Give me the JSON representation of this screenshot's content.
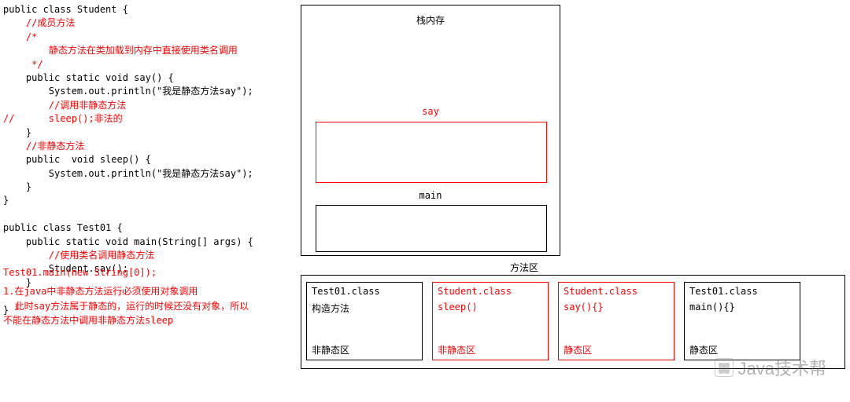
{
  "code": {
    "lines": [
      {
        "t": "public class Student {",
        "c": "blk"
      },
      {
        "t": "    //成员方法",
        "c": "red"
      },
      {
        "t": "    /*",
        "c": "red"
      },
      {
        "t": "        静态方法在类加载到内存中直接使用类名调用",
        "c": "red"
      },
      {
        "t": "     */",
        "c": "red"
      },
      {
        "t": "    public static void say() {",
        "c": "blk"
      },
      {
        "t": "        System.out.println(\"我是静态方法say\");",
        "c": "blk"
      },
      {
        "t": "        //调用非静态方法",
        "c": "red"
      },
      {
        "t": "//      sleep();非法的",
        "c": "red"
      },
      {
        "t": "    }",
        "c": "blk"
      },
      {
        "t": "    //非静态方法",
        "c": "red"
      },
      {
        "t": "    public  void sleep() {",
        "c": "blk"
      },
      {
        "t": "        System.out.println(\"我是静态方法say\");",
        "c": "blk"
      },
      {
        "t": "    }",
        "c": "blk"
      },
      {
        "t": "}",
        "c": "blk"
      },
      {
        "t": "",
        "c": "blk"
      },
      {
        "t": "public class Test01 {",
        "c": "blk"
      },
      {
        "t": "    public static void main(String[] args) {",
        "c": "blk"
      },
      {
        "t": "        //使用类名调用静态方法",
        "c": "red"
      },
      {
        "t": "        Student.say();",
        "c": "blk"
      },
      {
        "t": "    }",
        "c": "blk"
      },
      {
        "t": "",
        "c": "blk"
      },
      {
        "t": "}",
        "c": "blk"
      }
    ]
  },
  "notes": {
    "run": "Test01.main(new String[0]);",
    "explain": "1.在java中非静态方法运行必须使用对象调用\n  此时say方法属于静态的，运行的时候还没有对象，所以不能在静态方法中调用非静态方法sleep"
  },
  "stack": {
    "title": "栈内存",
    "say_label": "say",
    "main_label": "main"
  },
  "method_area": {
    "title": "方法区",
    "b1": {
      "title": "Test01.class",
      "mid": "构造方法",
      "bottom": "非静态区"
    },
    "b2": {
      "title": "Student.class",
      "mid": "sleep()",
      "bottom": "非静态区"
    },
    "b3": {
      "title": "Student.class",
      "mid": "say(){}",
      "bottom": "静态区"
    },
    "b4": {
      "title": "Test01.class",
      "mid": "main(){}",
      "bottom": "静态区"
    }
  },
  "watermark": "Java技术帮"
}
